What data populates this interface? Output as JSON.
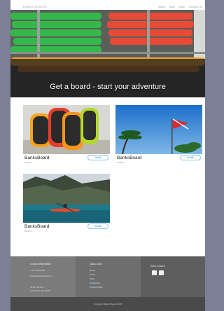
{
  "nav": {
    "brand": "BANKS BOARDS",
    "links": [
      "About",
      "Blog",
      "Shop",
      "Contact Us"
    ]
  },
  "hero": {
    "title": "Get a board - start your adventure"
  },
  "products": [
    {
      "name": "BanksBoard",
      "sub": "BANKS",
      "button": "Details"
    },
    {
      "name": "BanksBoard",
      "sub": "BANKS",
      "button": "Details"
    },
    {
      "name": "BanksBoard",
      "sub": "BANKS",
      "button": "Details"
    }
  ],
  "footer": {
    "contact": {
      "heading": "Contact Information",
      "lines": [
        "1-717-555-5555",
        "info@banksboards.com",
        "",
        "123 E. 1st Ave",
        "Columbus, OH 43215"
      ]
    },
    "quicklinks": {
      "heading": "Quick Links",
      "links": [
        "Home",
        "About",
        "Shop",
        "Contact Us",
        "Privacy Policy"
      ]
    },
    "social": {
      "heading": "Keep in touch",
      "icons": [
        "instagram-icon",
        "facebook-icon"
      ]
    },
    "copyright": "Copyright Banks Boards 2018"
  },
  "colors": {
    "page_bg": "#7d7f97",
    "accent": "#2a8fc0",
    "footer_dark": "#4a4a4a"
  }
}
